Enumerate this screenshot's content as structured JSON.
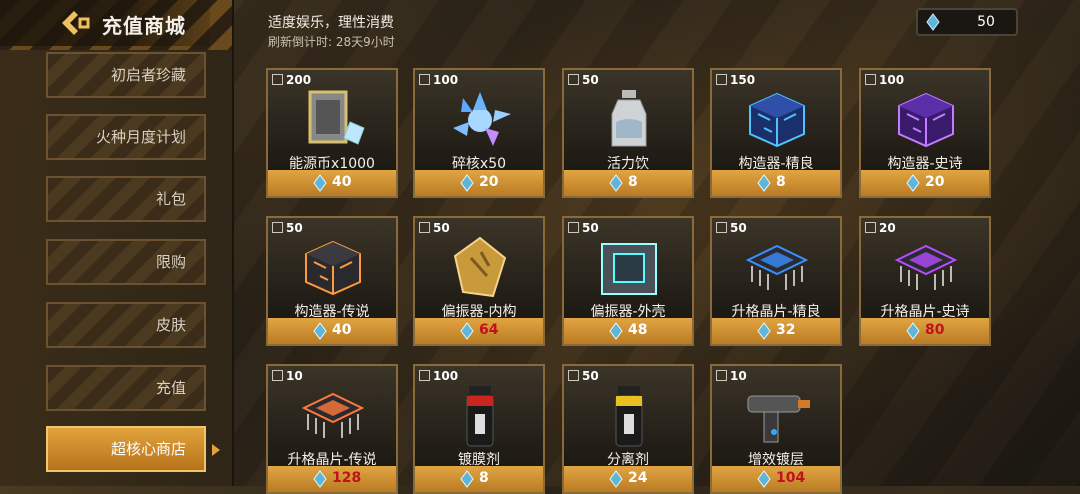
{
  "header": {
    "title": "充值商城",
    "note": "适度娱乐，理性消费",
    "timer": "刷新倒计时: 28天9小时",
    "currency_value": "50"
  },
  "sidebar": {
    "items": [
      {
        "label": "初启者珍藏"
      },
      {
        "label": "火种月度计划"
      },
      {
        "label": "礼包"
      },
      {
        "label": "限购"
      },
      {
        "label": "皮肤"
      },
      {
        "label": "充值"
      },
      {
        "label": "超核心商店"
      }
    ],
    "active_index": 6
  },
  "icons": {
    "back": "back-arrow-icon",
    "currency": "crystal-icon",
    "stock": "box-icon"
  },
  "colors": {
    "accent": "#e1a33c",
    "price_red": "#c1121b",
    "crystal": "#5fb6d9"
  },
  "shop": {
    "items": [
      {
        "stock": "200",
        "name": "能源币x1000",
        "price": "40",
        "price_red": false,
        "art": "energy-coin"
      },
      {
        "stock": "100",
        "name": "碎核x50",
        "price": "20",
        "price_red": false,
        "art": "shattered-core"
      },
      {
        "stock": "50",
        "name": "活力饮",
        "price": "8",
        "price_red": false,
        "art": "vitality-drink"
      },
      {
        "stock": "150",
        "name": "构造器-精良",
        "price": "8",
        "price_red": false,
        "art": "constructor-blue"
      },
      {
        "stock": "100",
        "name": "构造器-史诗",
        "price": "20",
        "price_red": false,
        "art": "constructor-purple"
      },
      {
        "stock": "50",
        "name": "构造器-传说",
        "price": "40",
        "price_red": false,
        "art": "constructor-orange"
      },
      {
        "stock": "50",
        "name": "偏振器-内构",
        "price": "64",
        "price_red": true,
        "art": "polarizer-gold"
      },
      {
        "stock": "50",
        "name": "偏振器-外壳",
        "price": "48",
        "price_red": false,
        "art": "polarizer-shell"
      },
      {
        "stock": "50",
        "name": "升格晶片-精良",
        "price": "32",
        "price_red": false,
        "art": "chip-blue"
      },
      {
        "stock": "20",
        "name": "升格晶片-史诗",
        "price": "80",
        "price_red": true,
        "art": "chip-purple"
      },
      {
        "stock": "10",
        "name": "升格晶片-传说",
        "price": "128",
        "price_red": true,
        "art": "chip-orange"
      },
      {
        "stock": "100",
        "name": "镀膜剂",
        "price": "8",
        "price_red": false,
        "art": "coating-spray"
      },
      {
        "stock": "50",
        "name": "分离剂",
        "price": "24",
        "price_red": false,
        "art": "separator-spray"
      },
      {
        "stock": "10",
        "name": "增效镀层",
        "price": "104",
        "price_red": true,
        "art": "enhancer-gun"
      }
    ]
  }
}
